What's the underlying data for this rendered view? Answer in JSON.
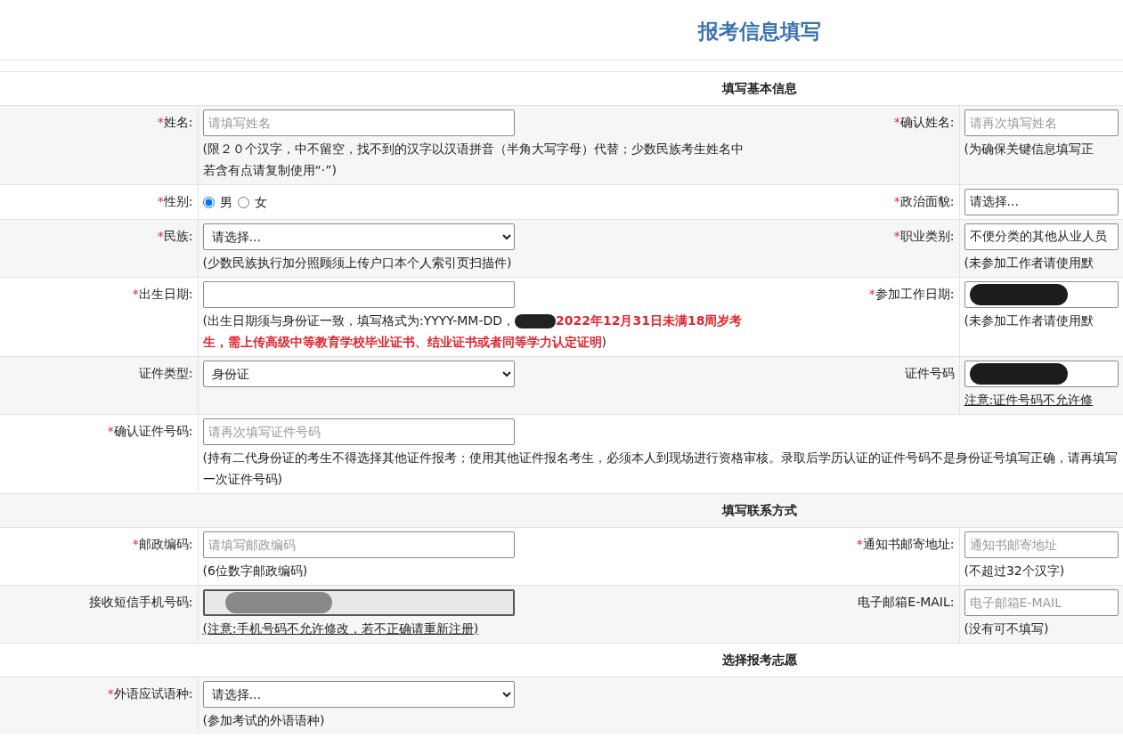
{
  "title": "报考信息填写",
  "sections": [
    {
      "heading": "填写基本信息",
      "rows": [
        {
          "fields": [
            {
              "label": "姓名:",
              "required_mark": "*",
              "kind": "text",
              "placeholder": "请填写姓名",
              "hint": [
                {
                  "kind": "plain",
                  "text": "(限２０个汉字，中不留空，找不到的汉字以汉语拼音（半角大写字母）代替；少数民族考生姓名中若含有点请复制使用“·”)"
                }
              ]
            },
            {
              "label": "确认姓名:",
              "required_mark": "*",
              "kind": "text",
              "placeholder": "请再次填写姓名",
              "hint": [
                {
                  "kind": "plain",
                  "text": "(为确保关键信息填写正"
                }
              ]
            }
          ]
        },
        {
          "fields": [
            {
              "label": "性别:",
              "required_mark": "*",
              "kind": "radio",
              "options": [
                {
                  "text": "男",
                  "selected": true
                },
                {
                  "text": "女",
                  "selected": false
                }
              ]
            },
            {
              "label": "政治面貌:",
              "required_mark": "*",
              "kind": "select",
              "value": "请选择..."
            }
          ]
        },
        {
          "fields": [
            {
              "label": "民族:",
              "required_mark": "*",
              "kind": "select",
              "value": "请选择...",
              "hint": [
                {
                  "kind": "plain",
                  "text": "(少数民族执行加分照顾须上传户口本个人索引页扫描件)"
                }
              ]
            },
            {
              "label": "职业类别:",
              "required_mark": "*",
              "kind": "select",
              "value": "不便分类的其他从业人员",
              "hint": [
                {
                  "kind": "plain",
                  "text": "(未参加工作者请使用默"
                }
              ]
            }
          ]
        },
        {
          "fields": [
            {
              "label": "出生日期:",
              "required_mark": "*",
              "kind": "text",
              "hint": [
                {
                  "kind": "plain",
                  "text": "(出生日期须与身份证一致，填写格式为:YYYY-MM-DD，"
                },
                {
                  "kind": "redacted"
                },
                {
                  "kind": "warning",
                  "text": "2022年12月31日未满18周岁考生，需上传高级中等教育学校毕业证书、结业证书或者同等学力认定证明"
                },
                {
                  "kind": "plain",
                  "text": ")"
                }
              ]
            },
            {
              "label": "参加工作日期:",
              "required_mark": "*",
              "kind": "redacted",
              "hint": [
                {
                  "kind": "plain",
                  "text": "(未参加工作者请使用默"
                }
              ]
            }
          ]
        },
        {
          "fields": [
            {
              "label": "证件类型:",
              "kind": "select",
              "value": "身份证"
            },
            {
              "label": "证件号码",
              "kind": "redacted",
              "hint": [
                {
                  "kind": "note",
                  "text": "注意:证件号码不允许修"
                }
              ]
            }
          ]
        },
        {
          "fields": [
            {
              "label": "确认证件号码:",
              "required_mark": "*",
              "kind": "text",
              "placeholder": "请再次填写证件号码",
              "hint": [
                {
                  "kind": "plain",
                  "text": "(持有二代身份证的考生不得选择其他证件报考；使用其他证件报名考生，必须本人到现场进行资格审核。录取后学历认证的证件号码不是身份证号填写正确，请再填写一次证件号码)"
                }
              ]
            }
          ]
        }
      ]
    },
    {
      "heading": "填写联系方式",
      "rows": [
        {
          "fields": [
            {
              "label": "邮政编码:",
              "required_mark": "*",
              "kind": "text",
              "placeholder": "请填写邮政编码",
              "hint": [
                {
                  "kind": "plain",
                  "text": "(6位数字邮政编码)"
                }
              ]
            },
            {
              "label": "通知书邮寄地址:",
              "required_mark": "*",
              "kind": "text",
              "placeholder": "通知书邮寄地址",
              "hint": [
                {
                  "kind": "plain",
                  "text": "(不超过32个汉字)"
                }
              ]
            }
          ]
        },
        {
          "fields": [
            {
              "label": "接收短信手机号码:",
              "kind": "disabled",
              "hint": [
                {
                  "kind": "note",
                  "text": "(注意:手机号码不允许修改，若不正确请重新注册)"
                }
              ]
            },
            {
              "label": "电子邮箱E-MAIL:",
              "kind": "text",
              "placeholder": "电子邮箱E-MAIL",
              "hint": [
                {
                  "kind": "plain",
                  "text": "(没有可不填写)"
                }
              ]
            }
          ]
        }
      ]
    },
    {
      "heading": "选择报考志愿",
      "rows": [
        {
          "fields": [
            {
              "label": "外语应试语种:",
              "required_mark": "*",
              "kind": "select",
              "value": "请选择...",
              "hint": [
                {
                  "kind": "plain",
                  "text": "(参加考试的外语语种)"
                }
              ]
            }
          ]
        }
      ]
    }
  ]
}
